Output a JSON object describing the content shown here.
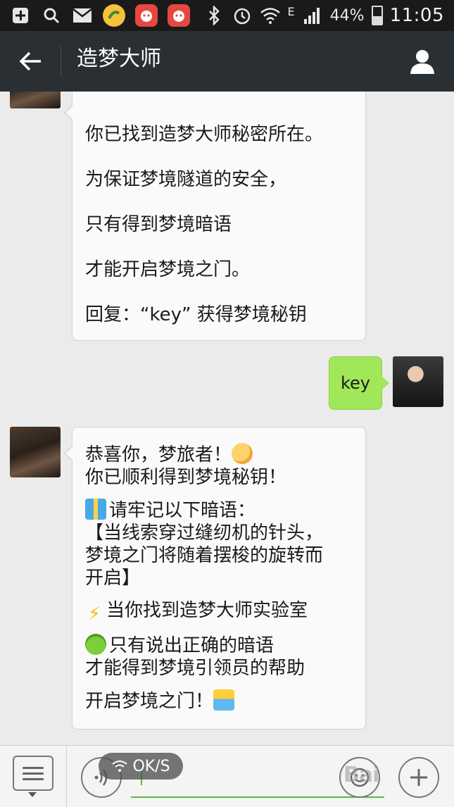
{
  "status_bar": {
    "battery_text": "44%",
    "time": "11:05",
    "network_type": "E",
    "icons": [
      "add-box-icon",
      "search-icon",
      "mail-icon",
      "app-badge-icon",
      "app-cat-icon",
      "app-cat-icon",
      "bluetooth-icon",
      "alarm-icon",
      "wifi-icon",
      "signal-icon",
      "battery-icon"
    ],
    "battery_level": 0.44
  },
  "header": {
    "title": "造梦大师",
    "icons": [
      "back-arrow-icon",
      "profile-icon"
    ]
  },
  "messages": [
    {
      "sender": "bot",
      "lines": [
        "你已找到造梦大师秘密所在。",
        "为保证梦境隧道的安全，",
        "只有得到梦境暗语",
        "才能开启梦境之门。",
        "回复：“key” 获得梦境秘钥"
      ]
    },
    {
      "sender": "user",
      "text": "key"
    },
    {
      "sender": "bot",
      "paragraphs": [
        [
          "恭喜你，梦旅者！",
          "你已顺利得到梦境秘钥！"
        ],
        [
          "请牢记以下暗语：",
          "【当线索穿过缝纫机的针头，",
          "梦境之门将随着摆梭的旋转而",
          "开启】"
        ],
        [
          "当你找到造梦大师实验室"
        ],
        [
          "只有说出正确的暗语",
          "才能得到梦境引领员的帮助"
        ],
        [
          "开启梦境之门！"
        ]
      ]
    }
  ],
  "input_bar": {
    "speed_badge": "OK/S",
    "watermark": "Bai",
    "icons": [
      "menu-icon",
      "voice-icon",
      "emoji-icon",
      "plus-icon"
    ]
  },
  "colors": {
    "title_bar": "#2a2f33",
    "status_bar": "#1a1a1a",
    "chat_background": "#ebebeb",
    "user_bubble": "#a0e759",
    "accent_green": "#5ab843"
  }
}
